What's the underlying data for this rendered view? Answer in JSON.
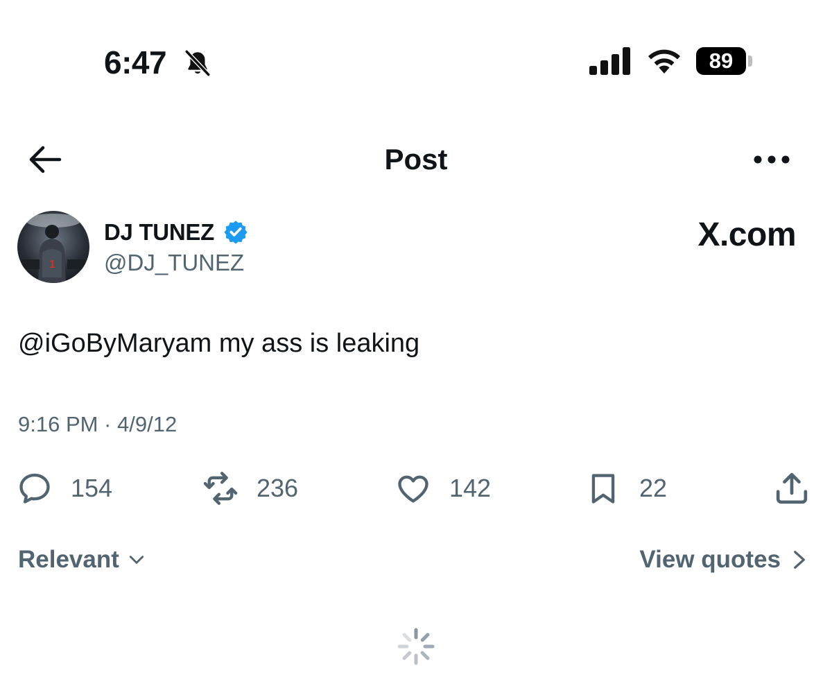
{
  "status_bar": {
    "time": "6:47",
    "battery": "89",
    "icons": [
      "bell-slash-icon",
      "signal-icon",
      "wifi-icon",
      "battery-icon"
    ]
  },
  "header": {
    "title": "Post",
    "back_icon": "arrow-left-icon",
    "more_icon": "more-horizontal-icon"
  },
  "post": {
    "author_name": "DJ TUNEZ",
    "author_handle": "@DJ_TUNEZ",
    "watermark": "X.com",
    "text": "@iGoByMaryam my ass is leaking",
    "timestamp": "9:16 PM · 4/9/12",
    "actions": {
      "replies": "154",
      "reposts": "236",
      "likes": "142",
      "bookmarks": "22"
    }
  },
  "filters": {
    "sort_label": "Relevant",
    "quotes_label": "View quotes"
  },
  "colors": {
    "text": "#0f1419",
    "secondary": "#536471",
    "verified": "#1d9bf0"
  }
}
